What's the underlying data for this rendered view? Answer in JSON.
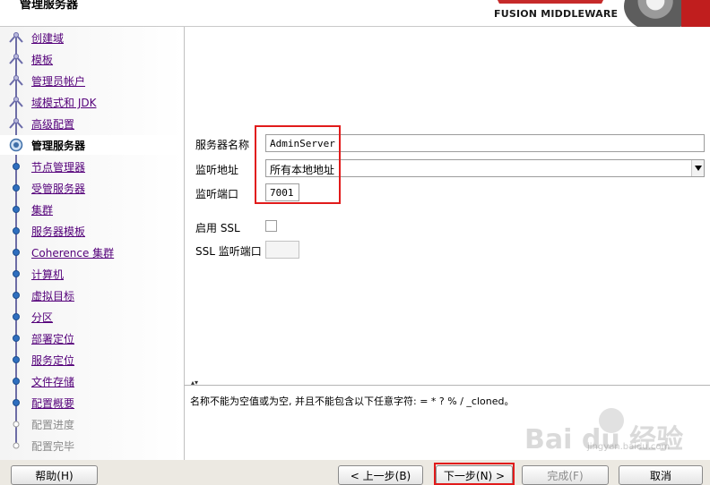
{
  "window": {
    "title": "管理服务器"
  },
  "brand": {
    "product_line": "FUSION MIDDLEWARE"
  },
  "nav": {
    "items": [
      {
        "label": "创建域",
        "state": "done"
      },
      {
        "label": "模板",
        "state": "done"
      },
      {
        "label": "管理员帐户",
        "state": "done"
      },
      {
        "label": "域模式和 JDK",
        "state": "done"
      },
      {
        "label": "高级配置",
        "state": "done"
      },
      {
        "label": "管理服务器",
        "state": "current"
      },
      {
        "label": "节点管理器",
        "state": "pending"
      },
      {
        "label": "受管服务器",
        "state": "pending"
      },
      {
        "label": "集群",
        "state": "pending"
      },
      {
        "label": "服务器模板",
        "state": "pending"
      },
      {
        "label": "Coherence 集群",
        "state": "pending"
      },
      {
        "label": "计算机",
        "state": "pending"
      },
      {
        "label": "虚拟目标",
        "state": "pending"
      },
      {
        "label": "分区",
        "state": "pending"
      },
      {
        "label": "部署定位",
        "state": "pending"
      },
      {
        "label": "服务定位",
        "state": "pending"
      },
      {
        "label": "文件存储",
        "state": "pending"
      },
      {
        "label": "配置概要",
        "state": "pending"
      },
      {
        "label": "配置进度",
        "state": "disabled"
      },
      {
        "label": "配置完毕",
        "state": "disabled"
      }
    ]
  },
  "form": {
    "server_name_label": "服务器名称",
    "server_name_value": "AdminServer",
    "listen_address_label": "监听地址",
    "listen_address_value": "所有本地地址",
    "listen_port_label": "监听端口",
    "listen_port_value": "7001",
    "enable_ssl_label": "启用 SSL",
    "enable_ssl_checked": false,
    "ssl_port_label": "SSL 监听端口",
    "ssl_port_value": ""
  },
  "message": {
    "text": "名称不能为空值或为空, 并且不能包含以下任意字符: = * ? % / _cloned。"
  },
  "watermark": {
    "text": "Bai du 经验",
    "url": "jingyan.baidu.com"
  },
  "buttons": {
    "help": "帮助(H)",
    "back": "< 上一步(B)",
    "next": "下一步(N) >",
    "finish": "完成(F)",
    "cancel": "取消"
  },
  "colors": {
    "highlight": "#e11b1b",
    "nav_link": "#54007a",
    "brand_red": "#c01e1e"
  }
}
